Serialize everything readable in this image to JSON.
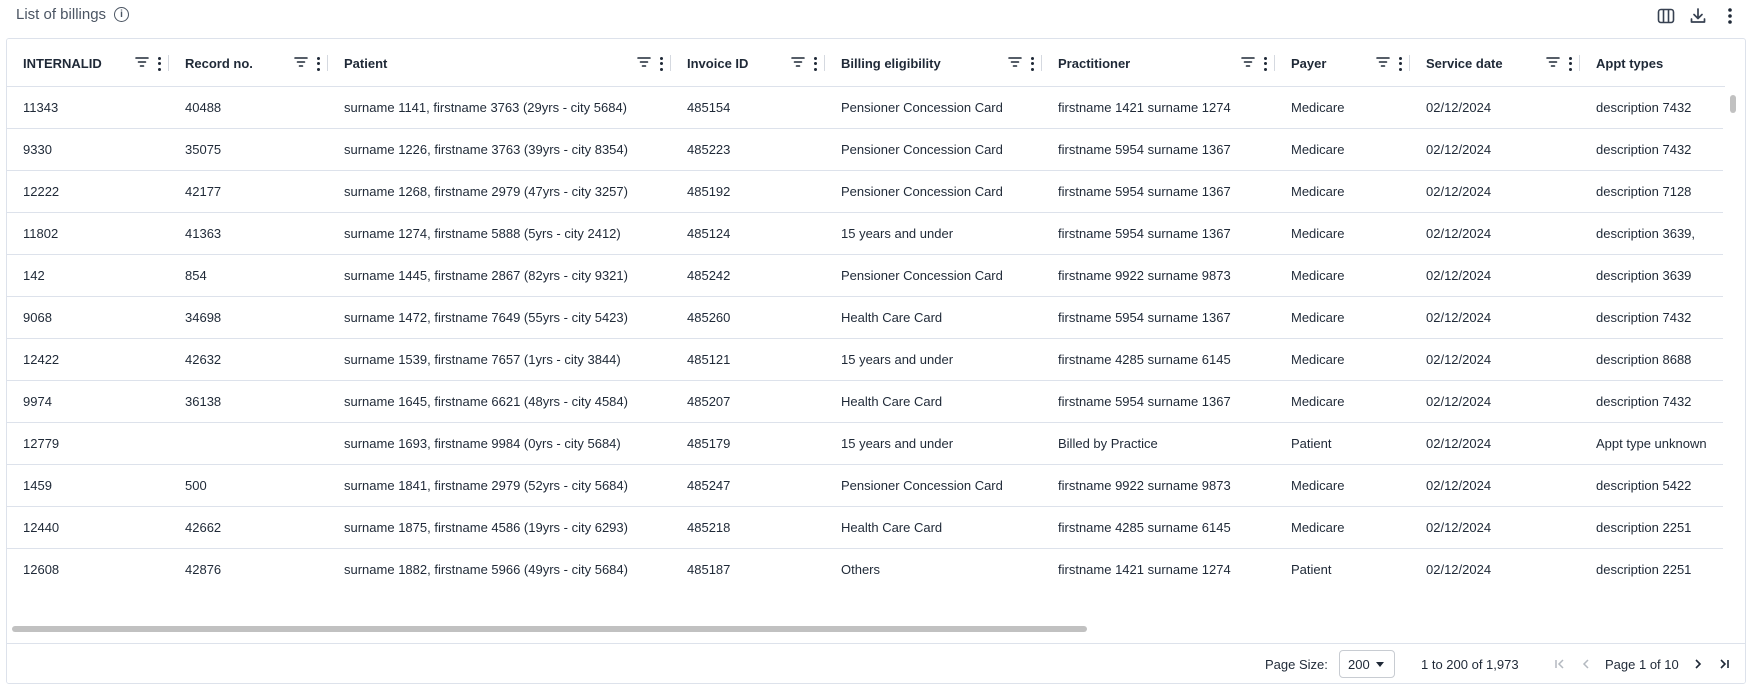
{
  "header": {
    "title": "List of billings",
    "info_icon": "info-icon",
    "actions": [
      {
        "name": "columns-icon"
      },
      {
        "name": "download-icon"
      },
      {
        "name": "more-vertical-icon"
      }
    ]
  },
  "columns": [
    {
      "label": "INTERNALID"
    },
    {
      "label": "Record no."
    },
    {
      "label": "Patient"
    },
    {
      "label": "Invoice ID"
    },
    {
      "label": "Billing eligibility"
    },
    {
      "label": "Practitioner"
    },
    {
      "label": "Payer"
    },
    {
      "label": "Service date"
    },
    {
      "label": "Appt types"
    }
  ],
  "rows": [
    [
      "11343",
      "40488",
      "surname 1141, firstname 3763 (29yrs - city 5684)",
      "485154",
      "Pensioner Concession Card",
      "firstname 1421 surname 1274",
      "Medicare",
      "02/12/2024",
      "description 7432"
    ],
    [
      "9330",
      "35075",
      "surname 1226, firstname 3763 (39yrs - city 8354)",
      "485223",
      "Pensioner Concession Card",
      "firstname 5954 surname 1367",
      "Medicare",
      "02/12/2024",
      "description 7432"
    ],
    [
      "12222",
      "42177",
      "surname 1268, firstname 2979 (47yrs - city 3257)",
      "485192",
      "Pensioner Concession Card",
      "firstname 5954 surname 1367",
      "Medicare",
      "02/12/2024",
      "description 7128"
    ],
    [
      "11802",
      "41363",
      "surname 1274, firstname 5888 (5yrs - city 2412)",
      "485124",
      "15 years and under",
      "firstname 5954 surname 1367",
      "Medicare",
      "02/12/2024",
      "description 3639,"
    ],
    [
      "142",
      "854",
      "surname 1445, firstname 2867 (82yrs - city 9321)",
      "485242",
      "Pensioner Concession Card",
      "firstname 9922 surname 9873",
      "Medicare",
      "02/12/2024",
      "description 3639"
    ],
    [
      "9068",
      "34698",
      "surname 1472, firstname 7649 (55yrs - city 5423)",
      "485260",
      "Health Care Card",
      "firstname 5954 surname 1367",
      "Medicare",
      "02/12/2024",
      "description 7432"
    ],
    [
      "12422",
      "42632",
      "surname 1539, firstname 7657 (1yrs - city 3844)",
      "485121",
      "15 years and under",
      "firstname 4285 surname 6145",
      "Medicare",
      "02/12/2024",
      "description 8688"
    ],
    [
      "9974",
      "36138",
      "surname 1645, firstname 6621 (48yrs - city 4584)",
      "485207",
      "Health Care Card",
      "firstname 5954 surname 1367",
      "Medicare",
      "02/12/2024",
      "description 7432"
    ],
    [
      "12779",
      "",
      "surname 1693, firstname 9984 (0yrs - city 5684)",
      "485179",
      "15 years and under",
      "Billed by Practice",
      "Patient",
      "02/12/2024",
      "Appt type unknown"
    ],
    [
      "1459",
      "500",
      "surname 1841, firstname 2979 (52yrs - city 5684)",
      "485247",
      "Pensioner Concession Card",
      "firstname 9922 surname 9873",
      "Medicare",
      "02/12/2024",
      "description 5422"
    ],
    [
      "12440",
      "42662",
      "surname 1875, firstname 4586 (19yrs - city 6293)",
      "485218",
      "Health Care Card",
      "firstname 4285 surname 6145",
      "Medicare",
      "02/12/2024",
      "description 2251"
    ],
    [
      "12608",
      "42876",
      "surname 1882, firstname 5966 (49yrs - city 5684)",
      "485187",
      "Others",
      "firstname 1421 surname 1274",
      "Patient",
      "02/12/2024",
      "description 2251"
    ]
  ],
  "footer": {
    "page_size_label": "Page Size:",
    "page_size_value": "200",
    "row_summary": "1 to 200 of 1,973",
    "page_desc": "Page 1 of 10"
  }
}
